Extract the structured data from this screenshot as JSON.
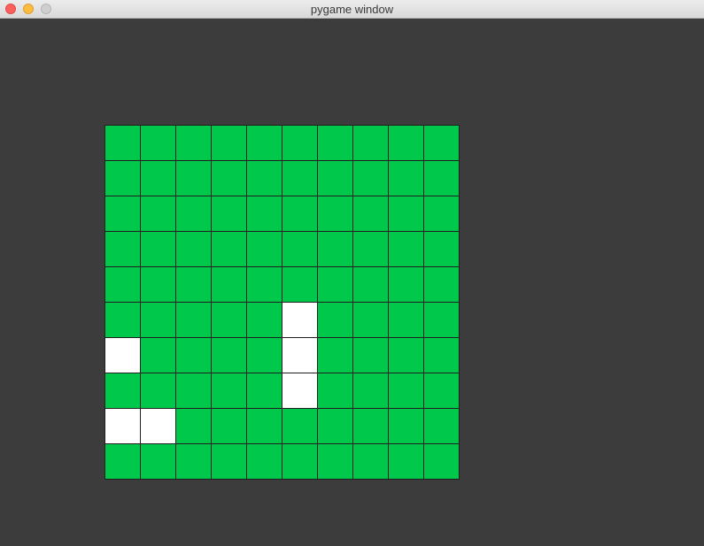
{
  "window": {
    "title": "pygame window",
    "background_color": "#3c3c3c"
  },
  "board": {
    "rows": 10,
    "cols": 10,
    "cell_color_on": "#00c84a",
    "cell_color_off": "#ffffff",
    "grid_line_color": "#1f1f1f",
    "white_cells": [
      [
        5,
        5
      ],
      [
        6,
        0
      ],
      [
        6,
        5
      ],
      [
        7,
        5
      ],
      [
        8,
        0
      ],
      [
        8,
        1
      ]
    ]
  }
}
